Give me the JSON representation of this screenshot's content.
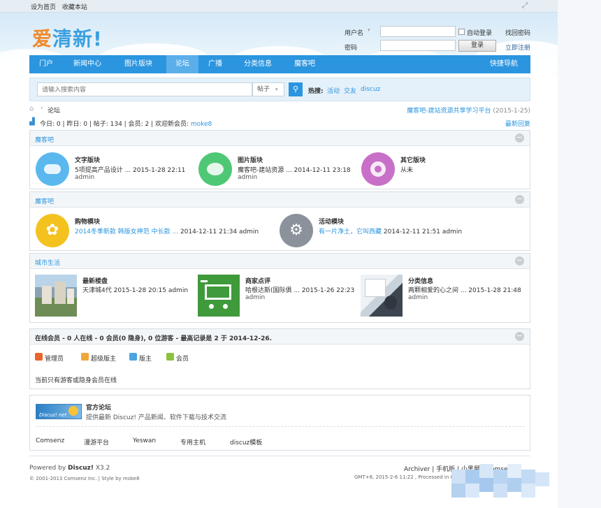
{
  "topbar": {
    "set_home": "设为首页",
    "bookmark": "收藏本站"
  },
  "logo": {
    "part1": "爱",
    "part2": "清新!"
  },
  "login": {
    "username_label": "用户名",
    "password_label": "密码",
    "auto_login": "自动登录",
    "find_password": "找回密码",
    "login_button": "登录",
    "register": "立即注册"
  },
  "nav": {
    "items": [
      {
        "label": "门户"
      },
      {
        "label": "新闻中心"
      },
      {
        "label": "图片版块"
      },
      {
        "label": "论坛"
      },
      {
        "label": "广播"
      },
      {
        "label": "分类信息"
      },
      {
        "label": "魔客吧"
      }
    ],
    "quick_nav": "快捷导航"
  },
  "search": {
    "placeholder": "请输入搜索内容",
    "scope": "帖子",
    "hot_label": "热搜:",
    "hot": [
      "活动",
      "交友",
      "discuz"
    ]
  },
  "breadcrumb": {
    "current": "论坛",
    "right_link": "魔客吧-建站资源共享学习平台",
    "right_date": "(2015-1-25)"
  },
  "stats": {
    "text": "今日: 0  |  昨日: 0  |  帖子: 134  |  会员: 2  |  欢迎新会员:",
    "new_member": "moke8",
    "latest_replies": "最新回复"
  },
  "sections": [
    {
      "title": "魔客吧",
      "forums": [
        {
          "name": "文字版块",
          "latest": "5项提高产品设计 ... 2015-1-28 22:11",
          "author": "admin",
          "color": "#5ab8ef"
        },
        {
          "name": "图片版块",
          "latest": "魔客吧-建站资源 ... 2014-12-11 23:18",
          "author": "admin",
          "color": "#4fc875"
        },
        {
          "name": "其它版块",
          "latest": "从未",
          "author": "",
          "color": "#c86fc8"
        }
      ]
    },
    {
      "title": "魔客吧",
      "forums": [
        {
          "name": "购物模块",
          "latest_link": "2014冬季新款 韩版女神范 中长款 ...",
          "latest_time": "2014-12-11 21:34",
          "author": "admin",
          "color": "#f4c21f"
        },
        {
          "name": "活动模块",
          "latest_link": "有一片净土，它叫西藏",
          "latest_time": "2014-12-11 21:51",
          "author": "admin",
          "color": "#8c929b"
        }
      ]
    },
    {
      "title": "城市生活",
      "forums": [
        {
          "name": "最新楼盘",
          "latest": "天津城4代 2015-1-28 20:15 admin",
          "author": ""
        },
        {
          "name": "商家点评",
          "latest": "哈根达斯(国际俱 ... 2015-1-26 22:23",
          "author": "admin"
        },
        {
          "name": "分类信息",
          "latest": "两颗相爱的心之间 ... 2015-1-28 21:48",
          "author": "admin"
        }
      ]
    }
  ],
  "online": {
    "title": "在线会员 - 0 人在线 - 0 会员(0 隐身), 0 位游客 - 最高记录是 2 于 2014-12-26.",
    "legend": [
      {
        "label": "管理员",
        "color": "#e9662c"
      },
      {
        "label": "超级版主",
        "color": "#f0a63a"
      },
      {
        "label": "版主",
        "color": "#4aa5e0"
      },
      {
        "label": "会员",
        "color": "#8cc23f"
      }
    ],
    "note": "当前只有游客或隐身会员在线"
  },
  "official": {
    "badge": "Discuz! net",
    "title": "官方论坛",
    "desc": "提供最新 Discuz! 产品新闻、软件下载与技术交流",
    "links": [
      "Comsenz",
      "漫游平台",
      "Yeswan",
      "专用主机",
      "discuz模板"
    ]
  },
  "footer": {
    "powered_prefix": "Powered by ",
    "powered_name": "Discuz!",
    "powered_version": " X3.2",
    "copyright": "© 2001-2013 Comsenz Inc.  |  Style by moke8",
    "right_links": "Archiver  |  手机版  |  小黑屋  |  Comsenz",
    "gmt": "GMT+8, 2015-2-6 11:22 , Processed in 0."
  }
}
